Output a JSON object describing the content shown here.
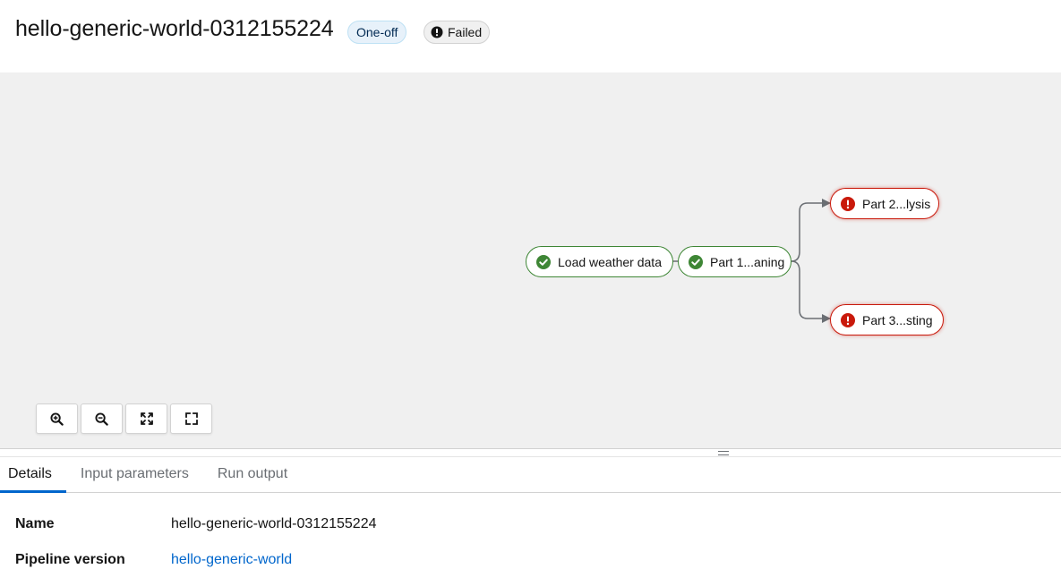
{
  "header": {
    "title": "hello-generic-world-0312155224",
    "run_type_badge": "One-off",
    "status_badge": "Failed"
  },
  "graph": {
    "nodes": [
      {
        "label": "Load weather data",
        "status": "succeeded"
      },
      {
        "label": "Part 1...aning",
        "status": "succeeded"
      },
      {
        "label": "Part 2...lysis",
        "status": "failed"
      },
      {
        "label": "Part 3...sting",
        "status": "failed"
      }
    ]
  },
  "zoom_controls": {
    "zoom_in": "zoom-in-icon",
    "zoom_out": "zoom-out-icon",
    "fit": "fit-to-screen-icon",
    "reset": "expand-icon"
  },
  "tabs": [
    "Details",
    "Input parameters",
    "Run output"
  ],
  "active_tab": "Details",
  "details": {
    "name_label": "Name",
    "name_value": "hello-generic-world-0312155224",
    "pipeline_version_label": "Pipeline version",
    "pipeline_version_value": "hello-generic-world"
  },
  "colors": {
    "success": "#3e8635",
    "danger": "#c9190b",
    "link": "#0066cc",
    "canvas_bg": "#f0f0f0"
  }
}
